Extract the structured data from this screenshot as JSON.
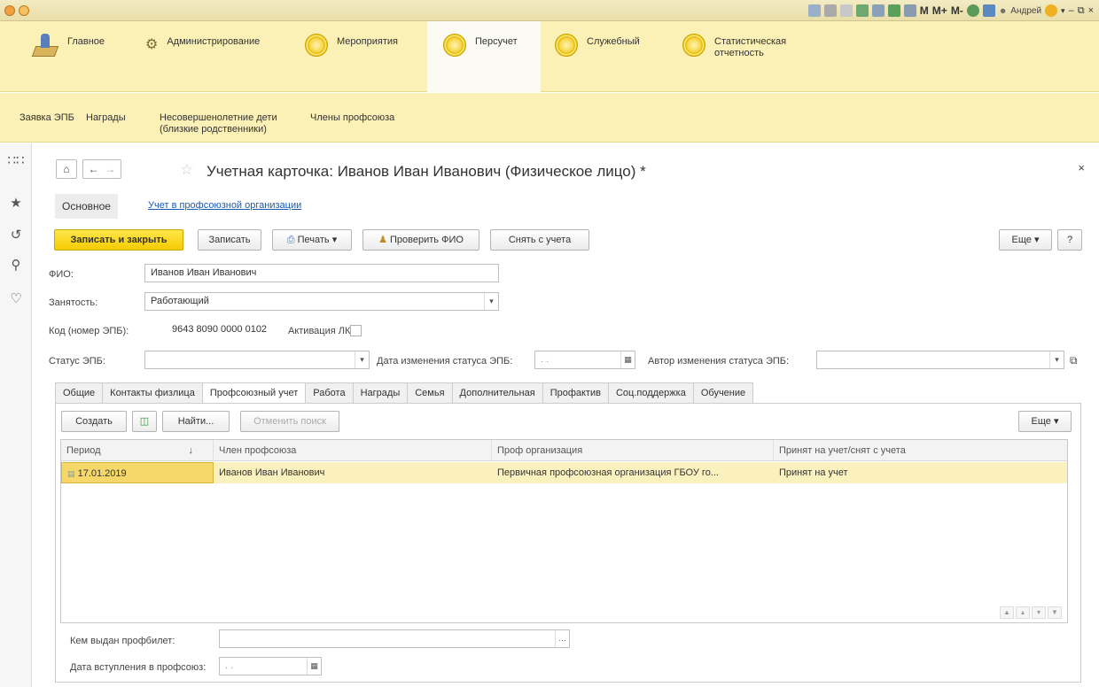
{
  "titlebar": {
    "user": "Андрей",
    "m_buttons": [
      "M",
      "M+",
      "M-"
    ]
  },
  "sections": [
    {
      "label": "Главное",
      "icon": "desk-icon"
    },
    {
      "label": "Администрирование",
      "icon": "gear-icon"
    },
    {
      "label": "Мероприятия",
      "icon": "circle-icon"
    },
    {
      "label": "Персучет",
      "icon": "circle-icon",
      "active": true
    },
    {
      "label": "Служебный",
      "icon": "circle-icon"
    },
    {
      "label": "Статистическая отчетность",
      "icon": "circle-icon"
    }
  ],
  "subnav": [
    {
      "label": "Заявка ЭПБ"
    },
    {
      "label": "Награды"
    },
    {
      "label": "Несовершенолетние дети (близкие родственники)"
    },
    {
      "label": "Члены профсоюза"
    }
  ],
  "form": {
    "title": "Учетная карточка: Иванов Иван Иванович (Физическое лицо) *",
    "tab_main": "Основное",
    "tab_link": "Учет в профсоюзной организации",
    "toolbar": {
      "save_close": "Записать и закрыть",
      "save": "Записать",
      "print": "Печать",
      "check_fio": "Проверить ФИО",
      "deregister": "Снять с учета",
      "more": "Еще",
      "help": "?"
    },
    "fields": {
      "fio_label": "ФИО:",
      "fio_value": "Иванов Иван Иванович",
      "employment_label": "Занятость:",
      "employment_value": "Работающий",
      "code_label": "Код (номер ЭПБ):",
      "code_value": "9643 8090 0000 0102",
      "activation_label": "Активация ЛК:",
      "status_label": "Статус ЭПБ:",
      "status_value": "",
      "status_date_label": "Дата изменения статуса ЭПБ:",
      "status_date_value": ". .",
      "status_author_label": "Автор изменения статуса ЭПБ:",
      "status_author_value": ""
    },
    "inner_tabs": [
      "Общие",
      "Контакты физлица",
      "Профсоюзный учет",
      "Работа",
      "Награды",
      "Семья",
      "Дополнительная",
      "Профактив",
      "Соц.поддержка",
      "Обучение"
    ],
    "inner_active": "Профсоюзный учет",
    "grid_toolbar": {
      "create": "Создать",
      "find": "Найти...",
      "cancel_search": "Отменить поиск",
      "more": "Еще"
    },
    "grid": {
      "columns": [
        "Период",
        "Член профсоюза",
        "Проф организация",
        "Принят на учет/снят с учета"
      ],
      "rows": [
        [
          "17.01.2019",
          "Иванов Иван Иванович",
          "Первичная профсоюзная организация ГБОУ го...",
          "Принят на учет"
        ]
      ]
    },
    "bottom": {
      "ticket_label": "Кем выдан профбилет:",
      "ticket_value": "",
      "join_label": "Дата вступления в профсоюз:",
      "join_value": ". ."
    }
  }
}
